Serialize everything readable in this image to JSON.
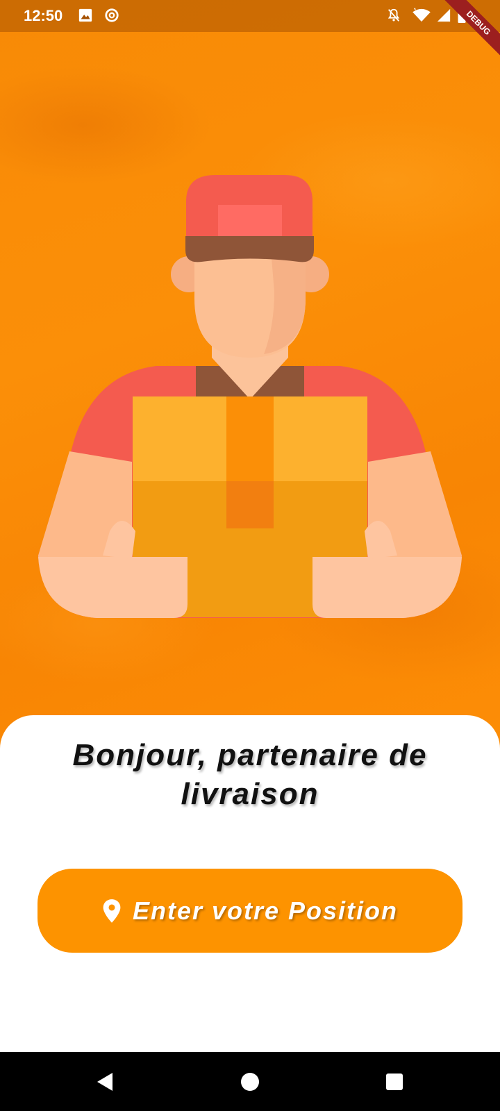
{
  "status_bar": {
    "time": "12:50",
    "left_icons": [
      "image-icon",
      "at-sign-icon"
    ],
    "right_icons": [
      "notifications-off-icon",
      "wifi-icon",
      "signal-icon",
      "battery-icon"
    ],
    "debug_banner": "DEBUG"
  },
  "hero": {
    "illustration": "delivery-man-holding-box",
    "background_color": "#ff8a00"
  },
  "welcome": {
    "title": "Bonjour, partenaire de livraison"
  },
  "action": {
    "button_label": "Enter votre Position",
    "button_icon": "location-pin-icon",
    "button_color": "#fd9300"
  },
  "nav_bar": {
    "buttons": [
      "back-triangle-icon",
      "home-circle-icon",
      "recents-square-icon"
    ]
  }
}
